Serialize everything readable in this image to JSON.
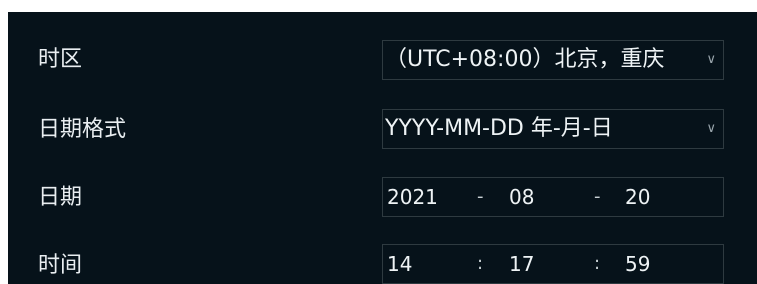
{
  "timezone": {
    "label": "时区",
    "value": "（UTC+08:00）北京，重庆",
    "dropdown_icon": "chevron-down-icon"
  },
  "date_format": {
    "label": "日期格式",
    "value": "YYYY-MM-DD 年-月-日",
    "dropdown_icon": "chevron-down-icon"
  },
  "date": {
    "label": "日期",
    "year": "2021",
    "month": "08",
    "day": "20",
    "separator": "-"
  },
  "time": {
    "label": "时间",
    "hour": "14",
    "minute": "17",
    "second": "59",
    "separator": ":"
  }
}
